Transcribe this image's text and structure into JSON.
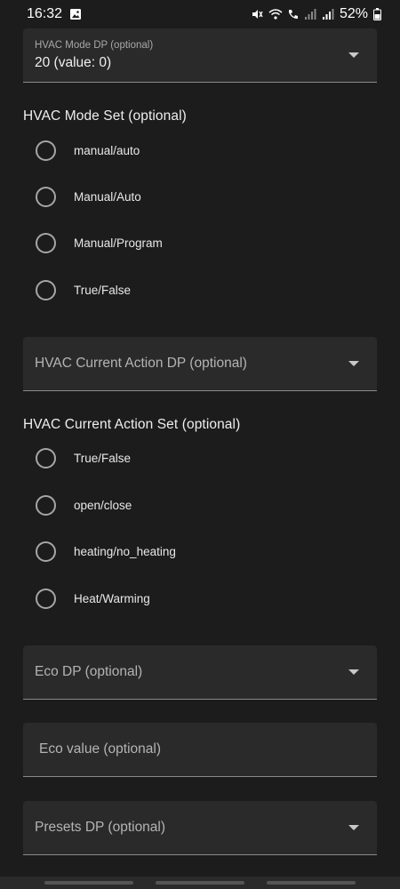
{
  "status_bar": {
    "time": "16:32",
    "battery": "52%",
    "icons": [
      "image-icon",
      "mute-icon",
      "wifi-icon",
      "wifi-call-icon",
      "signal-icon",
      "signal-icon",
      "battery-icon"
    ]
  },
  "hvac_mode_dp": {
    "label": "HVAC Mode DP (optional)",
    "value": "20 (value: 0)"
  },
  "hvac_mode_set": {
    "title": "HVAC Mode Set (optional)",
    "options": [
      "manual/auto",
      "Manual/Auto",
      "Manual/Program",
      "True/False"
    ]
  },
  "hvac_current_action_dp": {
    "placeholder": "HVAC Current Action DP (optional)"
  },
  "hvac_current_action_set": {
    "title": "HVAC Current Action Set (optional)",
    "options": [
      "True/False",
      "open/close",
      "heating/no_heating",
      "Heat/Warming"
    ]
  },
  "eco_dp": {
    "placeholder": "Eco DP (optional)"
  },
  "eco_value": {
    "placeholder": "Eco value (optional)"
  },
  "presets_dp": {
    "placeholder": "Presets DP (optional)"
  }
}
